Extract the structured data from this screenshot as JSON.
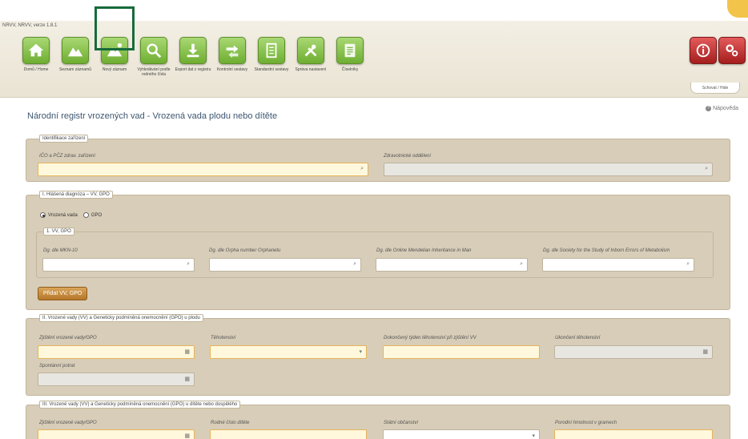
{
  "app": {
    "version": "NRVV, NRVV, verze 1.8.1"
  },
  "toolbar": {
    "items": [
      {
        "label": "Domů / Home"
      },
      {
        "label": "Seznam záznamů"
      },
      {
        "label": "Nový záznam"
      },
      {
        "label": "Vyhledávání podle rodného čísla"
      },
      {
        "label": "Export dat z registru"
      },
      {
        "label": "Kontrolní sestavy"
      },
      {
        "label": "Standardní sestavy"
      },
      {
        "label": "Správa nastavení"
      },
      {
        "label": "Číselníky"
      }
    ],
    "hide_label": "Schovat / Hide"
  },
  "page": {
    "title": "Národní registr vrozených vad - Vrozená vada plodu nebo dítěte",
    "help": "Nápověda"
  },
  "sec_id": {
    "legend": "Identifikace zařízení",
    "ico_label": "IČO a PČZ zdrav. zařízení",
    "dept_label": "Zdravotnické oddělení"
  },
  "sec_diag": {
    "legend": "I. Hlášená diagnóza – VV, GPO",
    "radio_vv": "Vrozená vada",
    "radio_gpo": "GPO",
    "sub_legend": "1. VV, GPO",
    "f1": "Dg. dle MKN-10",
    "f2": "Dg. dle Orpha number Orphanetu",
    "f3": "Dg. dle Online Mendelian Inheritance in Man",
    "f4": "Dg. dle Society for the Study of Inborn Errors of Metabolism",
    "add_button": "Přidat VV, GPO"
  },
  "sec_fetus": {
    "legend": "II. Vrozené vady (VV) a Geneticky podmíněná onemocnění (GPO) u plodu",
    "f1": "Zjištění vrozené vady/GPO",
    "f2": "Těhotenství",
    "f3": "Dokončený týden těhotenství při zjištění VV",
    "f4": "Ukončení těhotenství",
    "f5": "Spontánní potrat"
  },
  "sec_child": {
    "legend": "III. Vrozené vady (VV) a Geneticky podmíněná onemocnění (GPO) u dítěte nebo dospělého",
    "f1": "Zjištění vrozené vady/GPO",
    "f2": "Rodné číslo dítěte",
    "f3": "Státní občanství",
    "f4": "Porodní hmotnost v gramech"
  }
}
